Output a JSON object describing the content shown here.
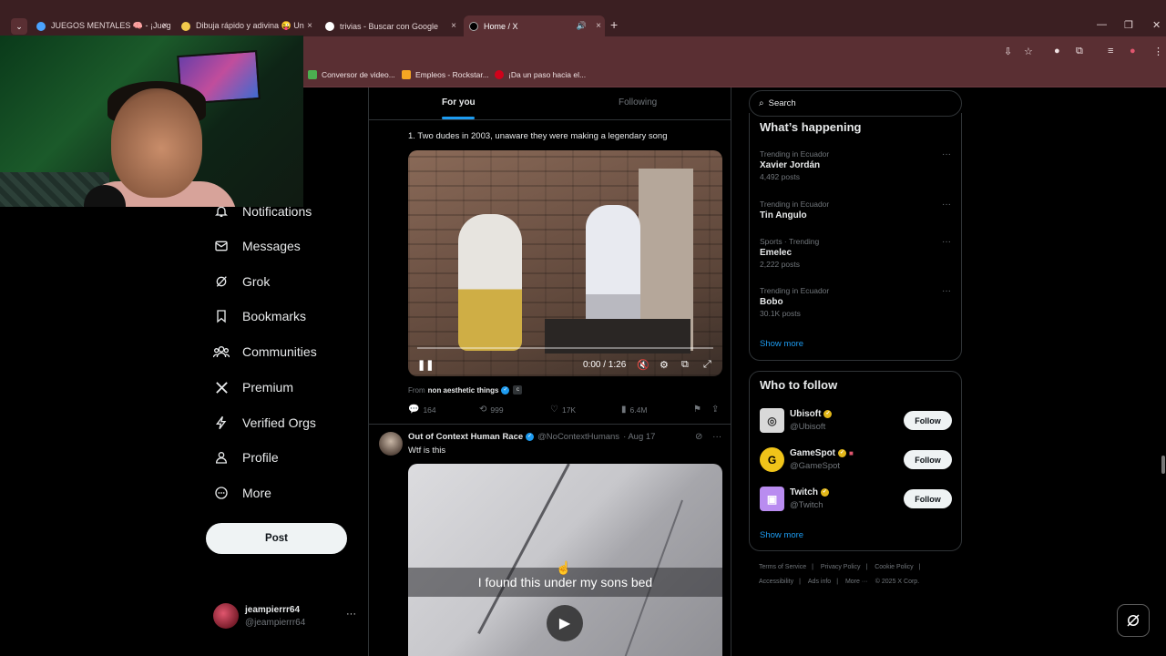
{
  "browser": {
    "tabs": [
      {
        "title": "JUEGOS MENTALES 🧠 - ¡Juega",
        "fav_color": "#4aa3ff"
      },
      {
        "title": "Dibuja rápido y adivina 😜 Un",
        "fav_color": "#f2c94c"
      },
      {
        "title": "trivias - Buscar con Google",
        "fav_color": "#ffffff"
      },
      {
        "title": "Home / X",
        "fav_color": "#000000"
      }
    ],
    "tab_close": "×",
    "new_tab": "+",
    "dropdown": "⌄",
    "mute_icon": "🔊",
    "window_min": "—",
    "window_max": "❐",
    "window_close": "✕",
    "bookmarks": [
      {
        "label": "Conversor de video...",
        "fav_color": "#4caf50"
      },
      {
        "label": "Empleos - Rockstar...",
        "fav_color": "#f5a623"
      },
      {
        "label": "¡Da un paso hacia el...",
        "fav_color": "#d0021b"
      }
    ]
  },
  "nav": {
    "items": [
      {
        "label": "Notifications",
        "icon": "bell-icon"
      },
      {
        "label": "Messages",
        "icon": "envelope-icon"
      },
      {
        "label": "Grok",
        "icon": "grok-icon"
      },
      {
        "label": "Bookmarks",
        "icon": "bookmark-icon"
      },
      {
        "label": "Communities",
        "icon": "communities-icon"
      },
      {
        "label": "Premium",
        "icon": "x-logo-icon"
      },
      {
        "label": "Verified Orgs",
        "icon": "lightning-icon"
      },
      {
        "label": "Profile",
        "icon": "person-icon"
      },
      {
        "label": "More",
        "icon": "more-circle-icon"
      }
    ],
    "post_label": "Post",
    "user": {
      "name": "jeampierrr64",
      "handle": "@jeampierrr64",
      "menu": "···"
    }
  },
  "feed": {
    "tabs": {
      "for_you": "For you",
      "following": "Following"
    },
    "tweet1": {
      "text": "1. Two dudes in 2003, unaware they were making a legendary song",
      "video": {
        "time": "0:00 / 1:26",
        "progress": 0.0
      },
      "from_prefix": "From",
      "from_name": "non aesthetic things",
      "from_badge": "c",
      "actions": {
        "replies": "164",
        "reposts": "999",
        "likes": "17K",
        "views": "6.4M"
      }
    },
    "tweet2": {
      "name": "Out of Context Human Race",
      "handle": "@NoContextHumans",
      "date": "· Aug 17",
      "text": "Wtf is this",
      "caption": "I found this under my sons bed"
    }
  },
  "sidebar": {
    "search_placeholder": "Search",
    "whats_happening": "What’s happening",
    "trends": [
      {
        "context": "Trending in Ecuador",
        "name": "Xavier Jordán",
        "count": "4,492 posts"
      },
      {
        "context": "Trending in Ecuador",
        "name": "Tin Angulo",
        "count": ""
      },
      {
        "context": "Sports · Trending",
        "name": "Emelec",
        "count": "2,222 posts"
      },
      {
        "context": "Trending in Ecuador",
        "name": "Bobo",
        "count": "30.1K posts"
      }
    ],
    "show_more": "Show more",
    "who_to_follow": "Who to follow",
    "accounts": [
      {
        "name": "Ubisoft",
        "handle": "@Ubisoft",
        "follow": "Follow",
        "color": "#d9d9d9"
      },
      {
        "name": "GameSpot",
        "handle": "@GameSpot",
        "follow": "Follow",
        "color": "#f0c419"
      },
      {
        "name": "Twitch",
        "handle": "@Twitch",
        "follow": "Follow",
        "color": "#b98cf0"
      }
    ],
    "show_more_2": "Show more",
    "footer": {
      "terms": "Terms of Service",
      "privacy": "Privacy Policy",
      "cookie": "Cookie Policy",
      "accessibility": "Accessibility",
      "ads": "Ads info",
      "more": "More ···",
      "copyright": "© 2025 X Corp."
    }
  }
}
